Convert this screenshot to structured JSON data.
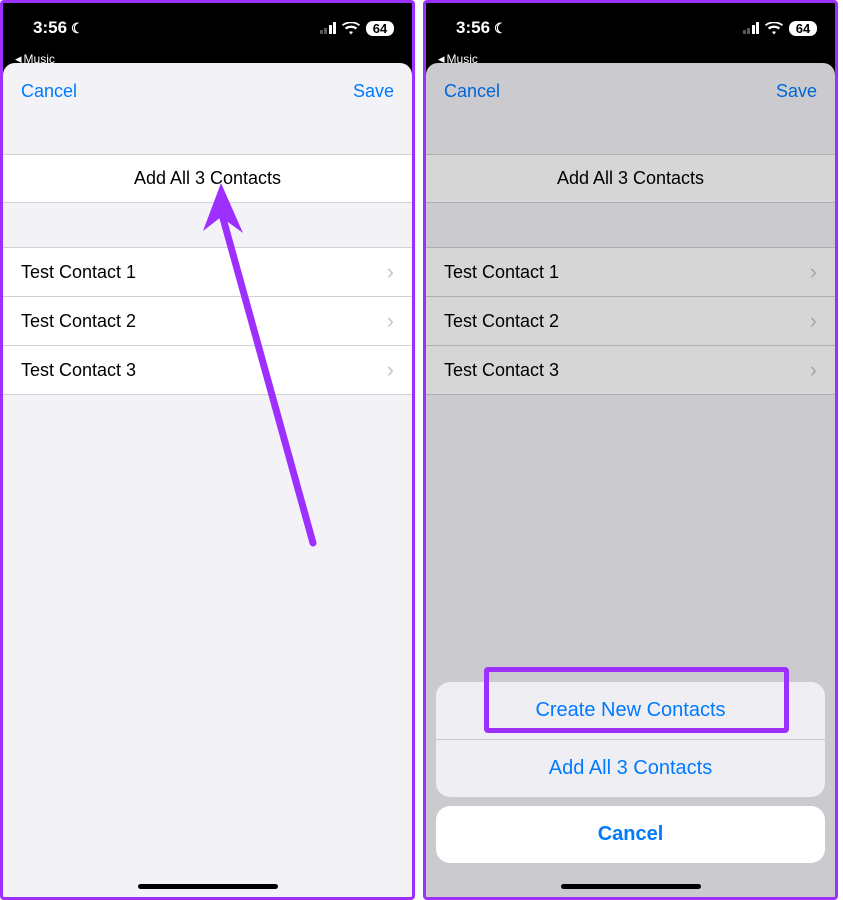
{
  "status": {
    "time": "3:56",
    "back_app": "Music",
    "battery": "64"
  },
  "modal": {
    "cancel": "Cancel",
    "save": "Save",
    "add_all": "Add All 3 Contacts"
  },
  "contacts": [
    {
      "name": "Test Contact 1"
    },
    {
      "name": "Test Contact 2"
    },
    {
      "name": "Test Contact 3"
    }
  ],
  "action_sheet": {
    "create": "Create New Contacts",
    "add_all": "Add All 3 Contacts",
    "cancel": "Cancel"
  },
  "colors": {
    "accent": "#007aff",
    "highlight": "#9d2fff"
  }
}
